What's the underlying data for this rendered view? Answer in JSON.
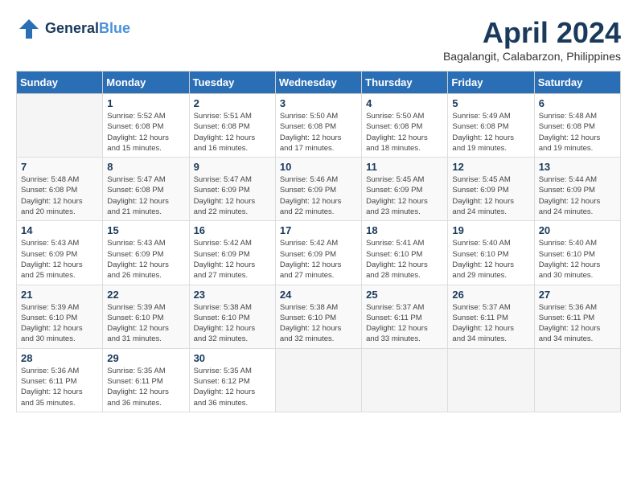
{
  "header": {
    "logo_line1": "General",
    "logo_line2": "Blue",
    "month_title": "April 2024",
    "subtitle": "Bagalangit, Calabarzon, Philippines"
  },
  "days_of_week": [
    "Sunday",
    "Monday",
    "Tuesday",
    "Wednesday",
    "Thursday",
    "Friday",
    "Saturday"
  ],
  "weeks": [
    [
      {
        "day": "",
        "info": ""
      },
      {
        "day": "1",
        "info": "Sunrise: 5:52 AM\nSunset: 6:08 PM\nDaylight: 12 hours\nand 15 minutes."
      },
      {
        "day": "2",
        "info": "Sunrise: 5:51 AM\nSunset: 6:08 PM\nDaylight: 12 hours\nand 16 minutes."
      },
      {
        "day": "3",
        "info": "Sunrise: 5:50 AM\nSunset: 6:08 PM\nDaylight: 12 hours\nand 17 minutes."
      },
      {
        "day": "4",
        "info": "Sunrise: 5:50 AM\nSunset: 6:08 PM\nDaylight: 12 hours\nand 18 minutes."
      },
      {
        "day": "5",
        "info": "Sunrise: 5:49 AM\nSunset: 6:08 PM\nDaylight: 12 hours\nand 19 minutes."
      },
      {
        "day": "6",
        "info": "Sunrise: 5:48 AM\nSunset: 6:08 PM\nDaylight: 12 hours\nand 19 minutes."
      }
    ],
    [
      {
        "day": "7",
        "info": "Sunrise: 5:48 AM\nSunset: 6:08 PM\nDaylight: 12 hours\nand 20 minutes."
      },
      {
        "day": "8",
        "info": "Sunrise: 5:47 AM\nSunset: 6:08 PM\nDaylight: 12 hours\nand 21 minutes."
      },
      {
        "day": "9",
        "info": "Sunrise: 5:47 AM\nSunset: 6:09 PM\nDaylight: 12 hours\nand 22 minutes."
      },
      {
        "day": "10",
        "info": "Sunrise: 5:46 AM\nSunset: 6:09 PM\nDaylight: 12 hours\nand 22 minutes."
      },
      {
        "day": "11",
        "info": "Sunrise: 5:45 AM\nSunset: 6:09 PM\nDaylight: 12 hours\nand 23 minutes."
      },
      {
        "day": "12",
        "info": "Sunrise: 5:45 AM\nSunset: 6:09 PM\nDaylight: 12 hours\nand 24 minutes."
      },
      {
        "day": "13",
        "info": "Sunrise: 5:44 AM\nSunset: 6:09 PM\nDaylight: 12 hours\nand 24 minutes."
      }
    ],
    [
      {
        "day": "14",
        "info": "Sunrise: 5:43 AM\nSunset: 6:09 PM\nDaylight: 12 hours\nand 25 minutes."
      },
      {
        "day": "15",
        "info": "Sunrise: 5:43 AM\nSunset: 6:09 PM\nDaylight: 12 hours\nand 26 minutes."
      },
      {
        "day": "16",
        "info": "Sunrise: 5:42 AM\nSunset: 6:09 PM\nDaylight: 12 hours\nand 27 minutes."
      },
      {
        "day": "17",
        "info": "Sunrise: 5:42 AM\nSunset: 6:09 PM\nDaylight: 12 hours\nand 27 minutes."
      },
      {
        "day": "18",
        "info": "Sunrise: 5:41 AM\nSunset: 6:10 PM\nDaylight: 12 hours\nand 28 minutes."
      },
      {
        "day": "19",
        "info": "Sunrise: 5:40 AM\nSunset: 6:10 PM\nDaylight: 12 hours\nand 29 minutes."
      },
      {
        "day": "20",
        "info": "Sunrise: 5:40 AM\nSunset: 6:10 PM\nDaylight: 12 hours\nand 30 minutes."
      }
    ],
    [
      {
        "day": "21",
        "info": "Sunrise: 5:39 AM\nSunset: 6:10 PM\nDaylight: 12 hours\nand 30 minutes."
      },
      {
        "day": "22",
        "info": "Sunrise: 5:39 AM\nSunset: 6:10 PM\nDaylight: 12 hours\nand 31 minutes."
      },
      {
        "day": "23",
        "info": "Sunrise: 5:38 AM\nSunset: 6:10 PM\nDaylight: 12 hours\nand 32 minutes."
      },
      {
        "day": "24",
        "info": "Sunrise: 5:38 AM\nSunset: 6:10 PM\nDaylight: 12 hours\nand 32 minutes."
      },
      {
        "day": "25",
        "info": "Sunrise: 5:37 AM\nSunset: 6:11 PM\nDaylight: 12 hours\nand 33 minutes."
      },
      {
        "day": "26",
        "info": "Sunrise: 5:37 AM\nSunset: 6:11 PM\nDaylight: 12 hours\nand 34 minutes."
      },
      {
        "day": "27",
        "info": "Sunrise: 5:36 AM\nSunset: 6:11 PM\nDaylight: 12 hours\nand 34 minutes."
      }
    ],
    [
      {
        "day": "28",
        "info": "Sunrise: 5:36 AM\nSunset: 6:11 PM\nDaylight: 12 hours\nand 35 minutes."
      },
      {
        "day": "29",
        "info": "Sunrise: 5:35 AM\nSunset: 6:11 PM\nDaylight: 12 hours\nand 36 minutes."
      },
      {
        "day": "30",
        "info": "Sunrise: 5:35 AM\nSunset: 6:12 PM\nDaylight: 12 hours\nand 36 minutes."
      },
      {
        "day": "",
        "info": ""
      },
      {
        "day": "",
        "info": ""
      },
      {
        "day": "",
        "info": ""
      },
      {
        "day": "",
        "info": ""
      }
    ]
  ]
}
